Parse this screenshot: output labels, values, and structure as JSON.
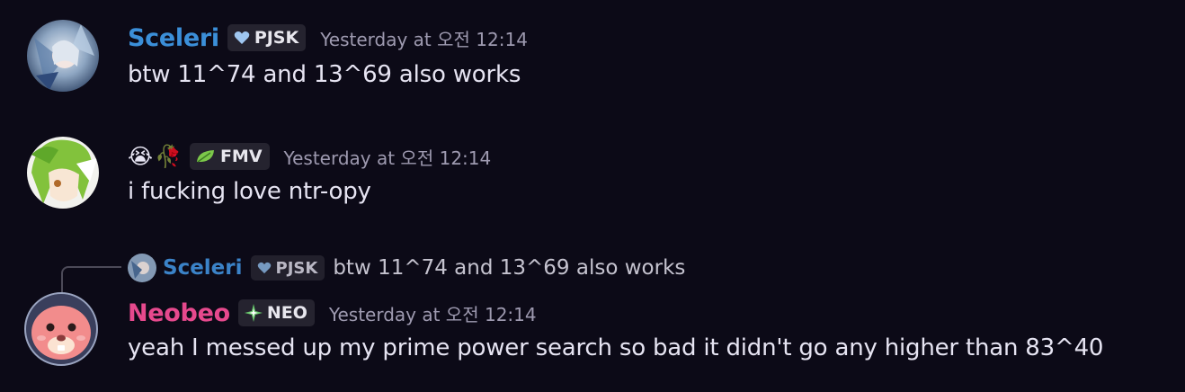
{
  "messages": [
    {
      "username": "Sceleri",
      "username_color": "#3b8fd9",
      "tag_label": "PJSK",
      "tag_icon": "heart-icon",
      "timestamp": "Yesterday at 오전 12:14",
      "content": "btw 11^74 and 13^69 also works"
    },
    {
      "username": "",
      "name_emojis": [
        "😭",
        "🥀"
      ],
      "tag_label": "FMV",
      "tag_icon": "leaf-icon",
      "timestamp": "Yesterday at 오전 12:14",
      "content": "i fucking love ntr-opy"
    },
    {
      "reply": {
        "username": "Sceleri",
        "tag_label": "PJSK",
        "tag_icon": "heart-icon",
        "text": "btw 11^74 and 13^69 also works"
      },
      "username": "Neobeo",
      "username_color": "#e6498d",
      "tag_label": "NEO",
      "tag_icon": "sparkle-icon",
      "timestamp": "Yesterday at 오전 12:14",
      "content": "yeah I messed up my prime power search so bad it didn't go any higher than 83^40"
    }
  ],
  "colors": {
    "background": "#0c0a17",
    "timestamp": "#9e9ab0",
    "tag_bg": "#25232f"
  }
}
